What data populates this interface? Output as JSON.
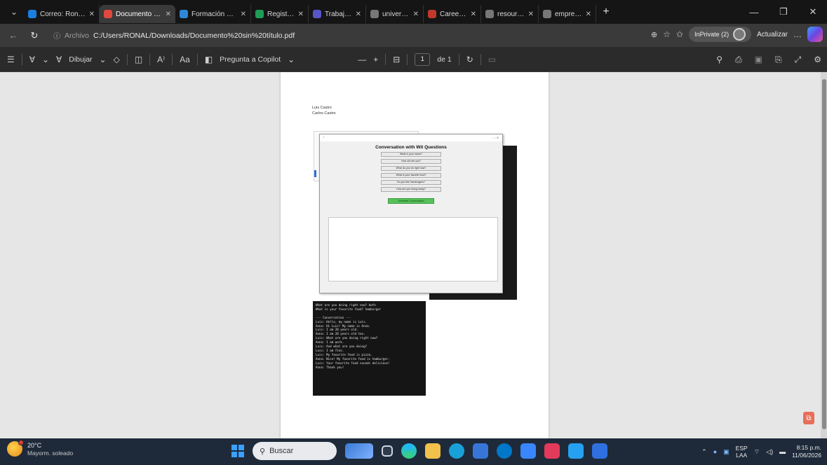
{
  "tabs": [
    {
      "title": "Correo: Ronald",
      "color": "#1c7fe0",
      "active": false
    },
    {
      "title": "Documento sin",
      "color": "#e0483d",
      "active": true
    },
    {
      "title": "Formación Téc",
      "color": "#2e88d8",
      "active": false
    },
    {
      "title": "Registro de Ac",
      "color": "#1f9d55",
      "active": false
    },
    {
      "title": "Trabajo y Cone",
      "color": "#5656c8",
      "active": false
    },
    {
      "title": "university com",
      "color": "#777777",
      "active": false
    },
    {
      "title": "Career impact",
      "color": "#c0392b",
      "active": false
    },
    {
      "title": "resources Engli",
      "color": "#777777",
      "active": false
    },
    {
      "title": "empresas de tr",
      "color": "#777777",
      "active": false
    }
  ],
  "address": {
    "archivo": "Archivo",
    "url": "C:/Users/RONAL/Downloads/Documento%20sin%20título.pdf"
  },
  "profile": {
    "label": "InPrivate (2)"
  },
  "actualizar": "Actualizar",
  "pdf_toolbar": {
    "draw_label": "Dibujar",
    "copilot_label": "Pregunta a Copilot",
    "page_current": "1",
    "page_total": "de 1"
  },
  "document": {
    "names": [
      "Luis Castro",
      "Carlos Castro"
    ],
    "gui_title": "Conversation with Wit Questions",
    "questions": [
      "What is your name?",
      "How old are you?",
      "What do you do right now?",
      "What is your favorite food?",
      "Do you like hamburgers?",
      "How are you doing today?"
    ],
    "generate_label": "Generate Conversation",
    "terminal_lines": [
      "What are you doing right now? both",
      "What is your favorite food? hamburger",
      "",
      "--- Conversation ---",
      "Luis: Hello, my name is Luis.",
      "Anna: Hi Luis! My name is Anna.",
      "Luis: I am 20 years old.",
      "Anna: I am 20 years old too.",
      "Luis: What are you doing right now?",
      "Anna: I am work.",
      "Luis: And what are you doing?",
      "Luis: I am fine.",
      "Luis: My favorite food is pizza.",
      "Anna: Nice! My favorite food is hamburger.",
      "Luis: Your favorite food sounds delicious!",
      "Anna: Thank you!"
    ]
  },
  "taskbar": {
    "temp": "20°C",
    "condition": "Mayorm. soleado",
    "search_placeholder": "Buscar",
    "lang_1": "ESP",
    "lang_2": "LAA",
    "time": "8:15 p.m.",
    "date": "11/06/2026"
  }
}
